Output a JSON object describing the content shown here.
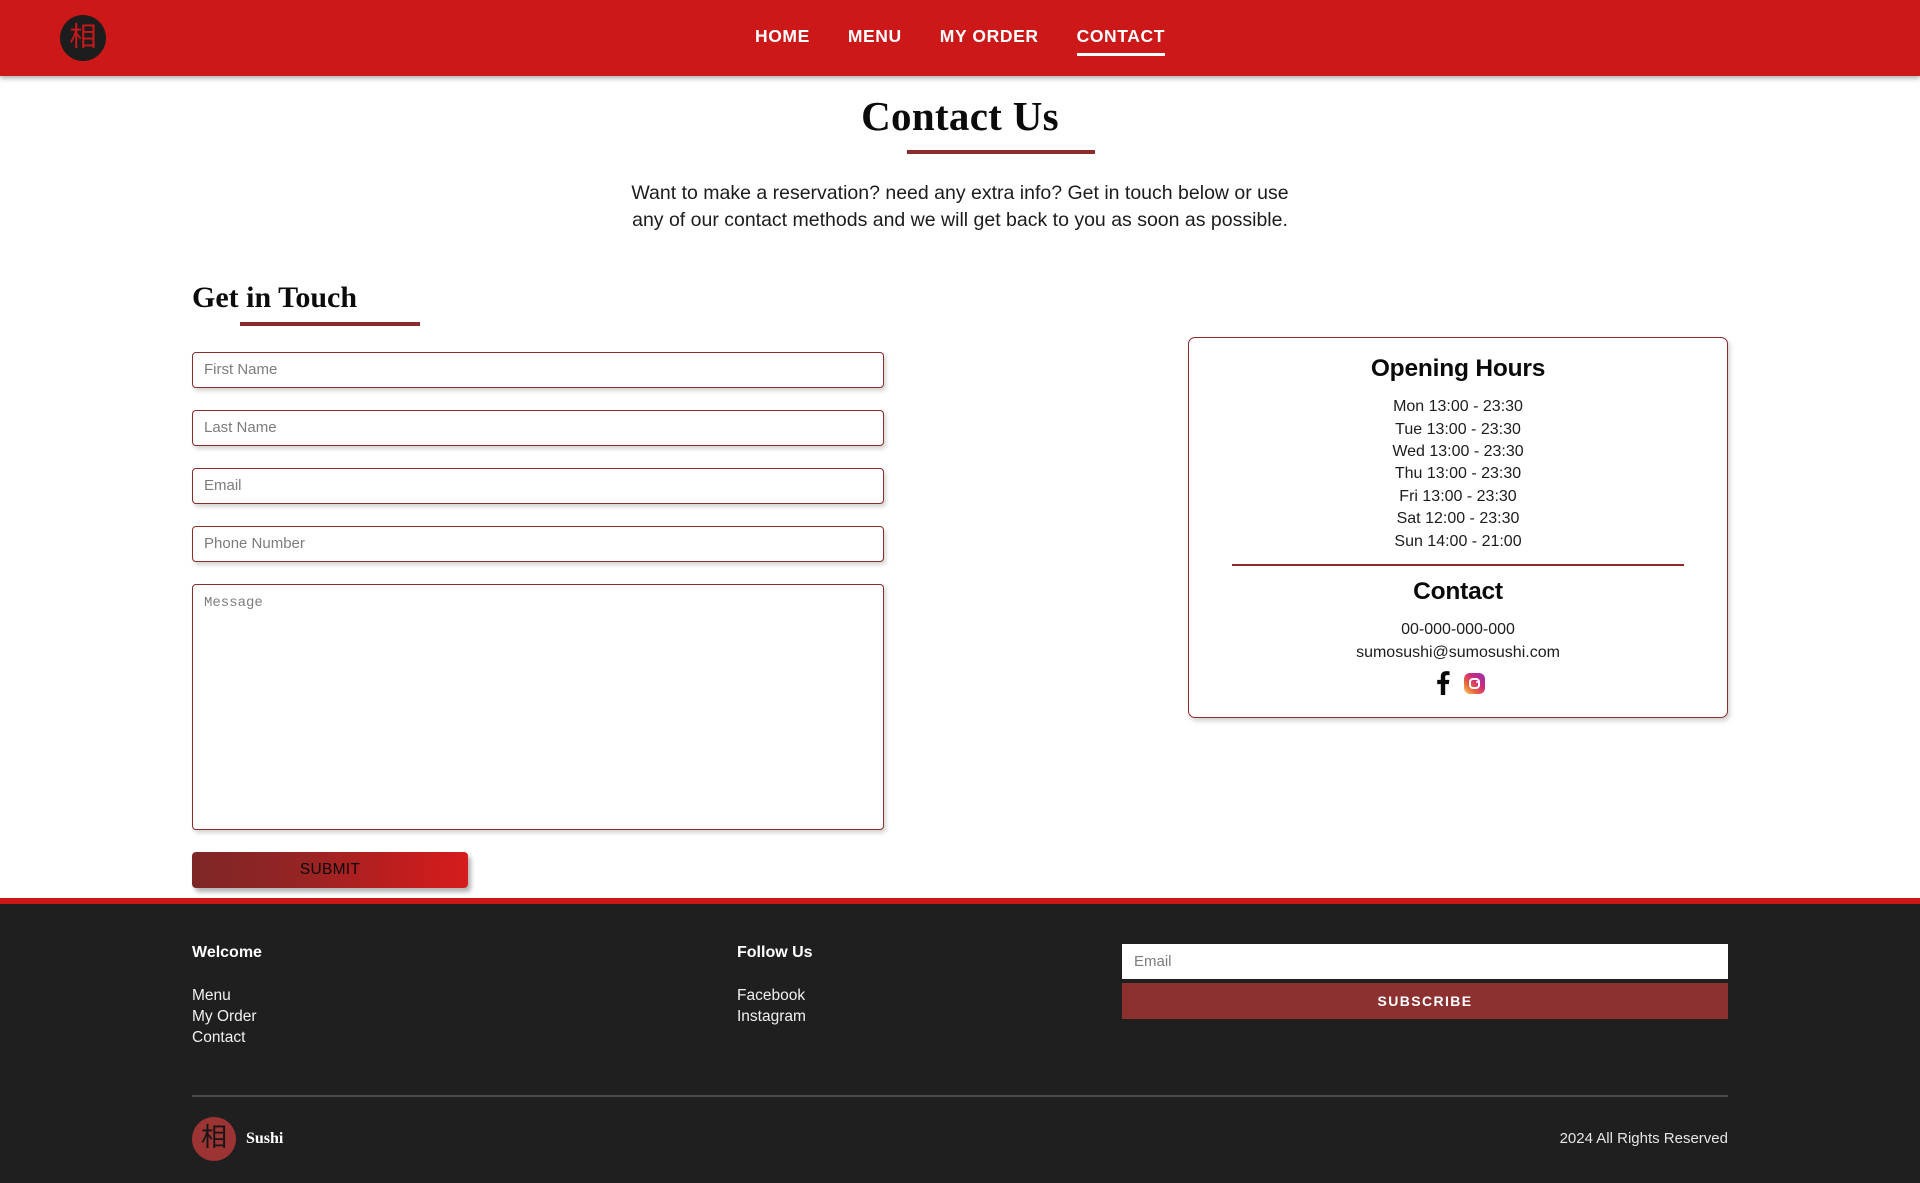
{
  "brand": {
    "logo_glyph": "相",
    "name": "Sushi"
  },
  "nav": {
    "items": [
      {
        "label": "HOME",
        "active": false
      },
      {
        "label": "MENU",
        "active": false
      },
      {
        "label": "MY ORDER",
        "active": false
      },
      {
        "label": "CONTACT",
        "active": true
      }
    ]
  },
  "hero": {
    "title": "Contact Us",
    "intro_line1": "Want to make a reservation? need any extra info? Get in touch below or use",
    "intro_line2": "any of our contact methods and we will get back to you as soon as possible."
  },
  "form": {
    "heading": "Get in Touch",
    "first_name_placeholder": "First Name",
    "last_name_placeholder": "Last Name",
    "email_placeholder": "Email",
    "phone_placeholder": "Phone Number",
    "message_placeholder": "Message",
    "submit_label": "SUBMIT"
  },
  "info_card": {
    "hours_title": "Opening Hours",
    "hours": [
      "Mon 13:00 - 23:30",
      "Tue 13:00 - 23:30",
      "Wed 13:00 - 23:30",
      "Thu 13:00 - 23:30",
      "Fri 13:00 - 23:30",
      "Sat 12:00 - 23:30",
      "Sun 14:00 - 21:00"
    ],
    "contact_title": "Contact",
    "phone": "00-000-000-000",
    "email": "sumosushi@sumosushi.com",
    "social": [
      {
        "name": "facebook-icon",
        "glyph": "f"
      },
      {
        "name": "instagram-icon",
        "glyph": ""
      }
    ]
  },
  "footer": {
    "welcome_heading": "Welcome",
    "welcome_links": [
      "Menu",
      "My Order",
      "Contact"
    ],
    "follow_heading": "Follow Us",
    "follow_links": [
      "Facebook",
      "Instagram"
    ],
    "subscribe_placeholder": "Email",
    "subscribe_label": "SUBSCRIBE",
    "copyright": "2024 All Rights Reserved"
  },
  "colors": {
    "brand_red": "#cc1818",
    "accent_dark_red": "#8c2b2b",
    "footer_bg": "#1f1f1f",
    "button_red": "#8c3030"
  }
}
